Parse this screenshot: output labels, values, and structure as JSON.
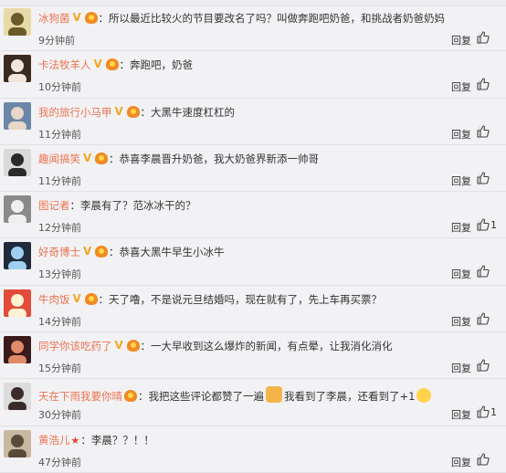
{
  "comments": [
    {
      "user": "冰狗菌",
      "badges": [
        "v",
        "medal"
      ],
      "text": "所以最近比较火的节目要改名了吗？叫做奔跑吧奶爸，和挑战者奶爸奶妈",
      "time": "9分钟前",
      "reply": "回复",
      "likes": "",
      "avatar": {
        "bg": "#e9d9a8",
        "fg": "#6b5a2a"
      }
    },
    {
      "user": "卡法牧羊人",
      "badges": [
        "v",
        "medal"
      ],
      "text": "奔跑吧，奶爸",
      "time": "10分钟前",
      "reply": "回复",
      "likes": "",
      "avatar": {
        "bg": "#3a2a22",
        "fg": "#f0e6dc"
      }
    },
    {
      "user": "我的旅行小马甲",
      "badges": [
        "v",
        "medal"
      ],
      "text": "大黑牛速度杠杠的",
      "time": "11分钟前",
      "reply": "回复",
      "likes": "",
      "avatar": {
        "bg": "#6b86a8",
        "fg": "#e6d7c8"
      }
    },
    {
      "user": "趣闻搞笑",
      "badges": [
        "v",
        "medal"
      ],
      "text": "恭喜李晨晋升奶爸，我大奶爸界新添一帅哥",
      "time": "11分钟前",
      "reply": "回复",
      "likes": "",
      "avatar": {
        "bg": "#d9d9d9",
        "fg": "#2a2a2a"
      }
    },
    {
      "user": "图记者",
      "badges": [],
      "text": "李晨有了？范冰冰干的？",
      "time": "12分钟前",
      "reply": "回复",
      "likes": "1",
      "avatar": {
        "bg": "#8a8a8a",
        "fg": "#efefef"
      }
    },
    {
      "user": "好奇博士",
      "badges": [
        "v",
        "medal"
      ],
      "text": "恭喜大黑牛早生小冰牛",
      "time": "13分钟前",
      "reply": "回复",
      "likes": "",
      "avatar": {
        "bg": "#1f2a3a",
        "fg": "#9fd0f0"
      }
    },
    {
      "user": "牛肉饭",
      "badges": [
        "v",
        "medal"
      ],
      "text": "天了噜，不是说元旦结婚吗，现在就有了，先上车再买票？",
      "time": "14分钟前",
      "reply": "回复",
      "likes": "",
      "avatar": {
        "bg": "#e24a3a",
        "fg": "#fff2d0"
      }
    },
    {
      "user": "同学你该吃药了",
      "badges": [
        "v",
        "medal"
      ],
      "text": "一大早收到这么爆炸的新闻，有点晕，让我消化消化",
      "time": "15分钟前",
      "reply": "回复",
      "likes": "",
      "avatar": {
        "bg": "#3a1a1a",
        "fg": "#e08a6a"
      }
    },
    {
      "user": "天在下雨我要你晴",
      "badges": [
        "medal"
      ],
      "text": "我把这些评论都赞了一遍",
      "text2": "我看到了李晨，还看到了+1",
      "time": "30分钟前",
      "reply": "回复",
      "likes": "1",
      "avatar": {
        "bg": "#dcdcdc",
        "fg": "#3a2a2a"
      }
    },
    {
      "user": "黄浩儿",
      "badges": [
        "star"
      ],
      "text": "李晨？？！！",
      "time": "47分钟前",
      "reply": "回复",
      "likes": "",
      "avatar": {
        "bg": "#c8b8a0",
        "fg": "#5a4a3a"
      }
    }
  ],
  "colors": {
    "username": "#eb7350",
    "vbadge": "#f5a623",
    "medal": "#f08a24"
  }
}
